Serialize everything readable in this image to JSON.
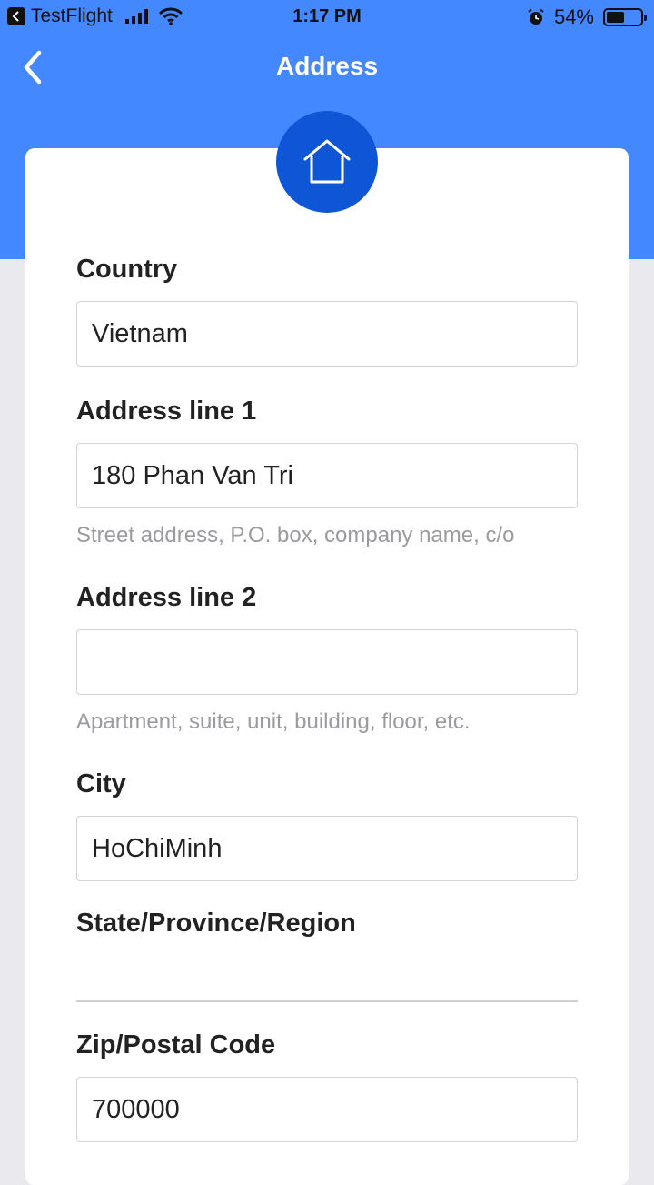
{
  "status_bar": {
    "app_name": "TestFlight",
    "time": "1:17 PM",
    "battery_percent_label": "54%",
    "battery_level": 0.54
  },
  "nav": {
    "title": "Address"
  },
  "form": {
    "country": {
      "label": "Country",
      "value": "Vietnam"
    },
    "address_line1": {
      "label": "Address line 1",
      "value": "180 Phan Van Tri",
      "hint": "Street address, P.O. box, company name, c/o"
    },
    "address_line2": {
      "label": "Address line 2",
      "value": "",
      "hint": "Apartment, suite, unit, building, floor, etc."
    },
    "city": {
      "label": "City",
      "value": "HoChiMinh"
    },
    "state": {
      "label": "State/Province/Region",
      "value": ""
    },
    "zip": {
      "label": "Zip/Postal Code",
      "value": "700000"
    }
  },
  "colors": {
    "header_blue": "#4488ff",
    "icon_circle_blue": "#0f56d6",
    "page_background": "#e9e9ee"
  }
}
